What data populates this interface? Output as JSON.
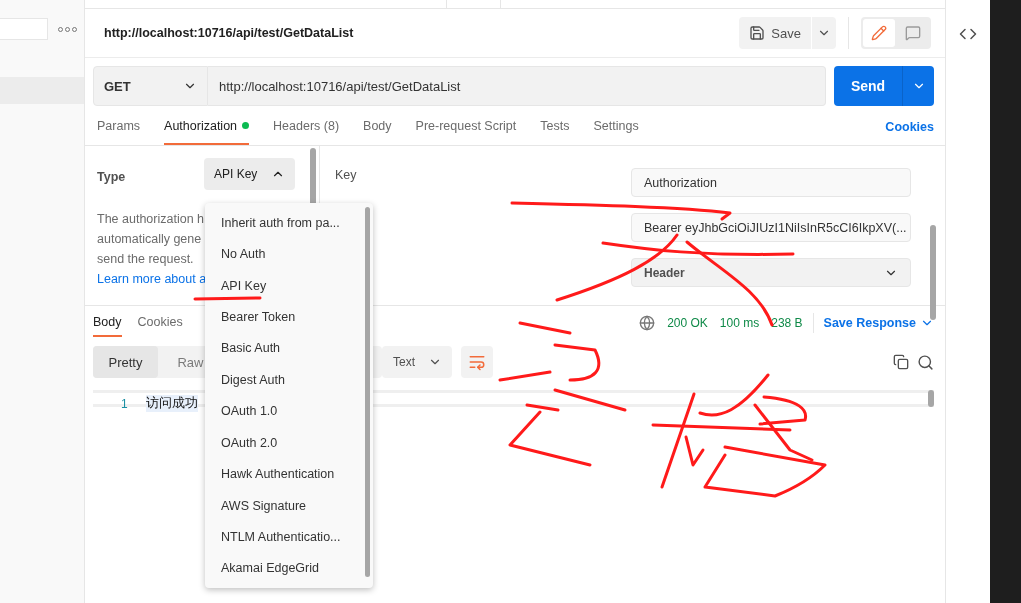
{
  "request_header": {
    "title": "http://localhost:10716/api/test/GetDataList",
    "save_label": "Save",
    "modes": [
      {
        "kind": "edit",
        "selected": true
      },
      {
        "kind": "comment",
        "selected": false
      }
    ]
  },
  "request": {
    "method": "GET",
    "url": "http://localhost:10716/api/test/GetDataList",
    "send_label": "Send"
  },
  "request_tabs": [
    {
      "label": "Params",
      "selected": false,
      "indicator": false
    },
    {
      "label": "Authorization",
      "selected": true,
      "indicator": true
    },
    {
      "label": "Headers (8)",
      "selected": false,
      "indicator": false
    },
    {
      "label": "Body",
      "selected": false,
      "indicator": false
    },
    {
      "label": "Pre-request Script",
      "selected": false,
      "indicator": false
    },
    {
      "label": "Tests",
      "selected": false,
      "indicator": false
    },
    {
      "label": "Settings",
      "selected": false,
      "indicator": false
    }
  ],
  "cookies_link": "Cookies",
  "auth": {
    "type_label": "Type",
    "type_value": "API Key",
    "type_expanded": true,
    "description_lines": [
      "The authorization h",
      "automatically gene",
      "send the request."
    ],
    "learn_more": "Learn more about a",
    "key_label": "Key",
    "key_value": "Authorization",
    "value": "Bearer eyJhbGciOiJIUzI1NiIsInR5cCI6IkpXV(...",
    "add_to": "Header"
  },
  "auth_menu": {
    "items": [
      "Inherit auth from pa...",
      "No Auth",
      "API Key",
      "Bearer Token",
      "Basic Auth",
      "Digest Auth",
      "OAuth 1.0",
      "OAuth 2.0",
      "Hawk Authentication",
      "AWS Signature",
      "NTLM Authenticatio...",
      "Akamai EdgeGrid"
    ]
  },
  "response": {
    "tabs": [
      {
        "label": "Body",
        "selected": true
      },
      {
        "label": "Cookies",
        "selected": false
      }
    ],
    "status": "200 OK",
    "time": "100 ms",
    "size": "238 B",
    "save_response": "Save Response",
    "formats": [
      {
        "label": "Pretty",
        "selected": true
      },
      {
        "label": "Raw",
        "selected": false
      }
    ],
    "language": "Text",
    "lines": [
      {
        "number": "1",
        "text": "访问成功"
      }
    ]
  }
}
